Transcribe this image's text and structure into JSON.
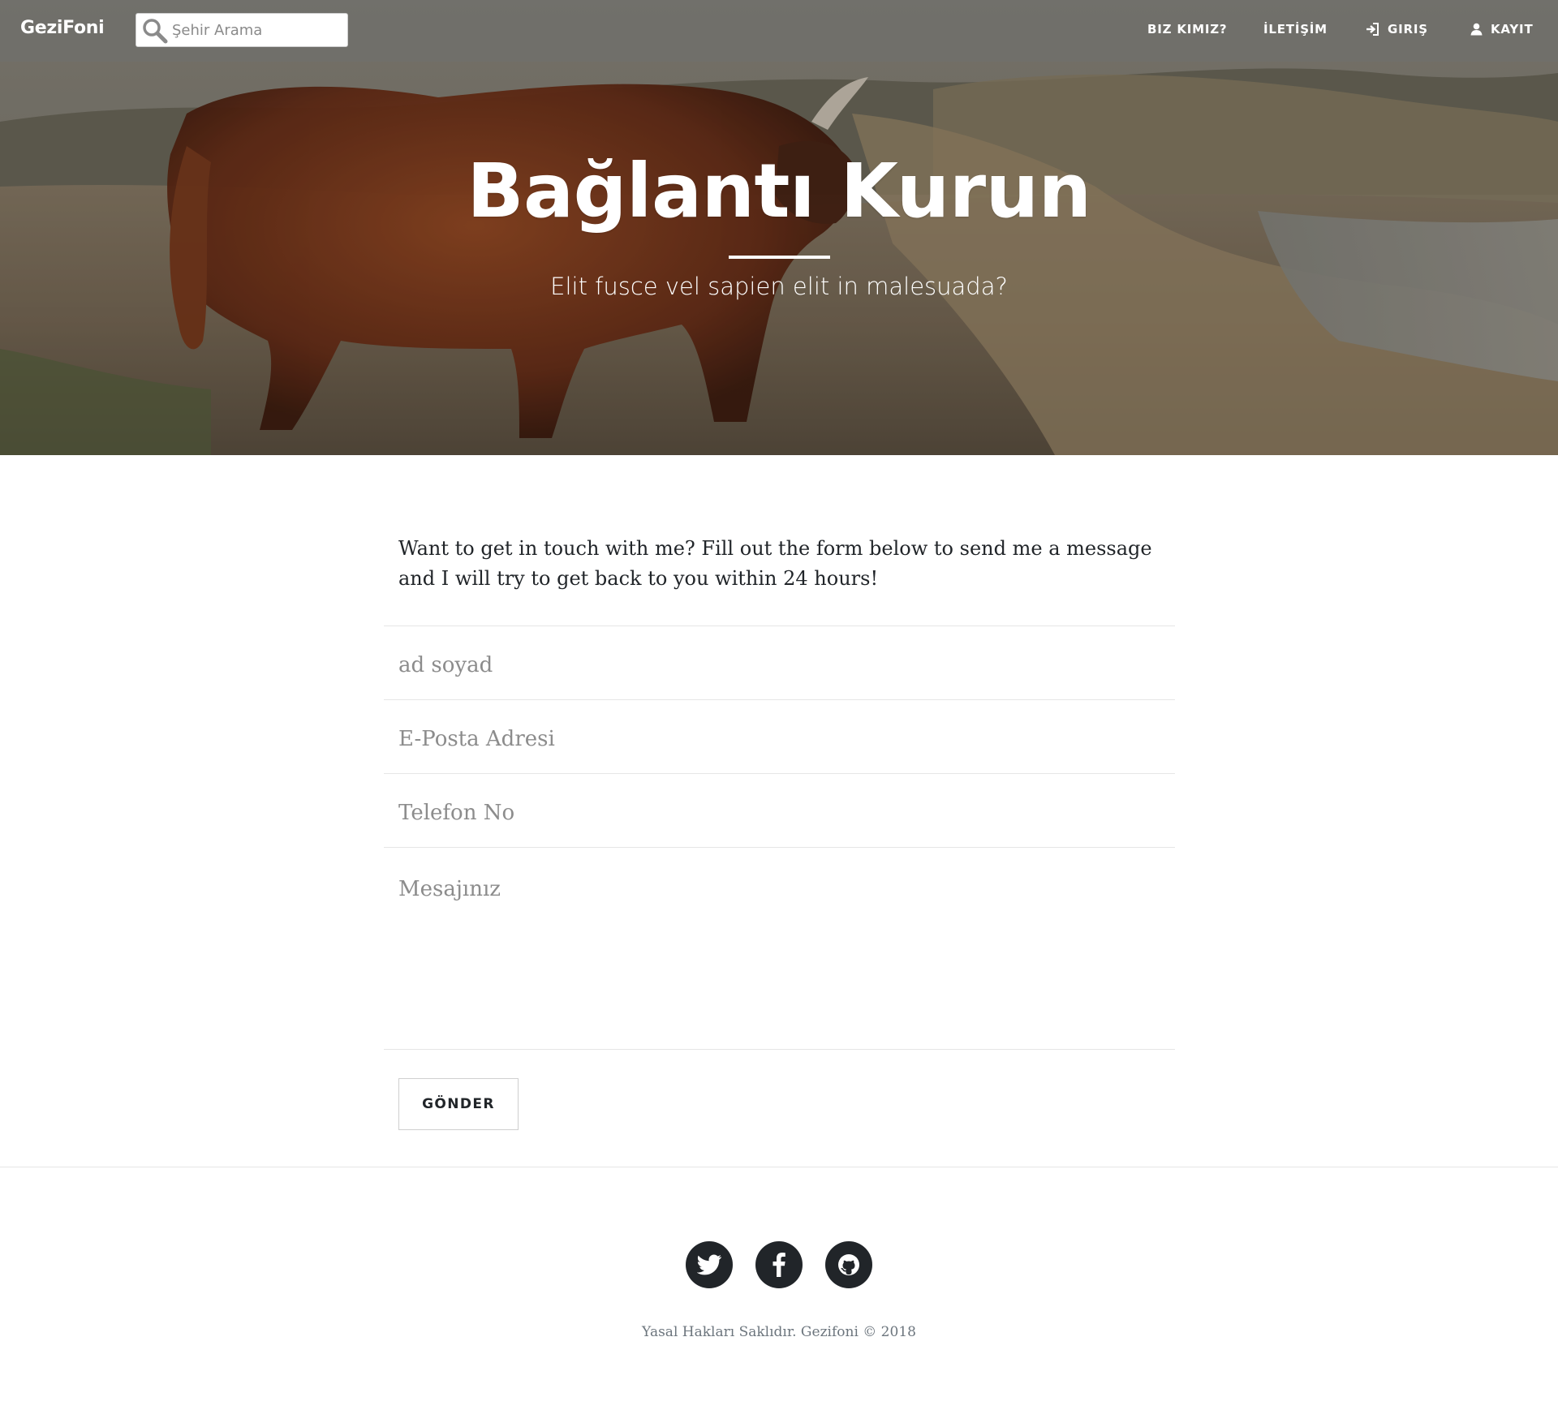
{
  "navbar": {
    "brand": "GeziFoni",
    "search_placeholder": "Şehir Arama",
    "items": [
      {
        "label": "BIZ KIMIZ?",
        "icon": ""
      },
      {
        "label": "İLETİŞİM",
        "icon": ""
      },
      {
        "label": "GIRIŞ",
        "icon": "login-icon"
      },
      {
        "label": "KAYIT",
        "icon": "user-icon"
      }
    ]
  },
  "hero": {
    "heading": "Bağlantı Kurun",
    "subheading": "Elit fusce vel sapien elit in malesuada?"
  },
  "contact": {
    "intro": "Want to get in touch with me? Fill out the form below to send me a message and I will try to get back to you within 24 hours!",
    "fields": {
      "name_placeholder": "ad soyad",
      "email_placeholder": "E-Posta Adresi",
      "phone_placeholder": "Telefon No",
      "message_placeholder": "Mesajınız"
    },
    "submit_label": "GÖNDER"
  },
  "footer": {
    "social": [
      {
        "name": "twitter",
        "icon": "twitter-icon"
      },
      {
        "name": "facebook",
        "icon": "facebook-icon"
      },
      {
        "name": "github",
        "icon": "github-icon"
      }
    ],
    "copyright": "Yasal Hakları Saklıdır. Gezifoni © 2018"
  },
  "colors": {
    "dark": "#212529",
    "muted": "#6c757d",
    "border": "#e6e6e6",
    "white": "#ffffff"
  }
}
